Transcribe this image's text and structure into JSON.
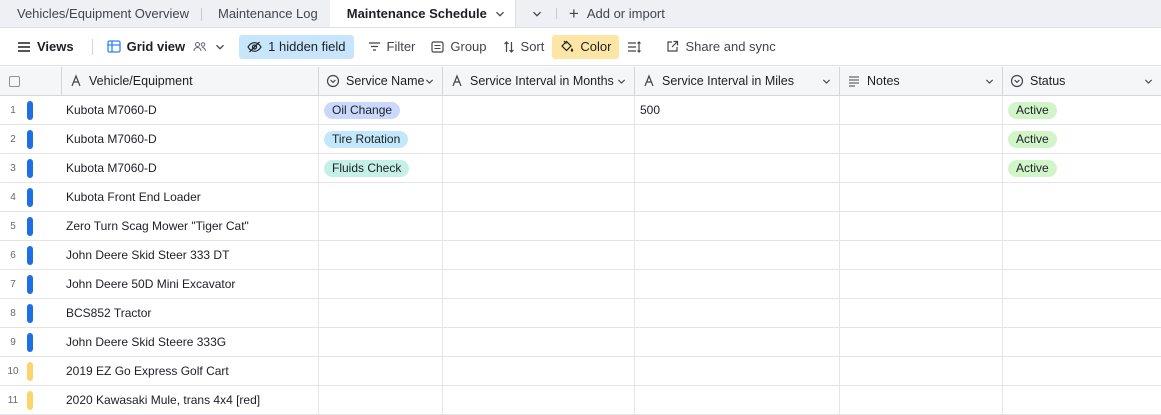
{
  "tabs": [
    {
      "label": "Vehicles/Equipment Overview",
      "active": false
    },
    {
      "label": "Maintenance Log",
      "active": false
    },
    {
      "label": "Maintenance Schedule",
      "active": true
    }
  ],
  "add_import_label": "Add or import",
  "toolbar": {
    "views": "Views",
    "grid_view": "Grid view",
    "hidden_field": "1 hidden field",
    "filter": "Filter",
    "group": "Group",
    "sort": "Sort",
    "color": "Color",
    "share": "Share and sync"
  },
  "columns": {
    "vehicle": "Vehicle/Equipment",
    "service_name": "Service Name",
    "interval_months": "Service Interval in Months",
    "interval_miles": "Service Interval in Miles",
    "notes": "Notes",
    "status": "Status"
  },
  "colors": {
    "blue_stripe": "#1e6fe6",
    "yellow_stripe": "#fcd56a",
    "oil_change": "#c9d8fb",
    "tire_rotation": "#c3e8fb",
    "fluids_check": "#c5f0e7",
    "active": "#d1f5c9"
  },
  "rows": [
    {
      "num": "1",
      "vehicle": "Kubota M7060-D",
      "service": "Oil Change",
      "service_color": "#c9d8fb",
      "months": "",
      "miles": "500",
      "notes": "",
      "status": "Active",
      "stripe": "#1e6fe6"
    },
    {
      "num": "2",
      "vehicle": "Kubota M7060-D",
      "service": "Tire Rotation",
      "service_color": "#c3e8fb",
      "months": "",
      "miles": "",
      "notes": "",
      "status": "Active",
      "stripe": "#1e6fe6"
    },
    {
      "num": "3",
      "vehicle": "Kubota M7060-D",
      "service": "Fluids Check",
      "service_color": "#c5f0e7",
      "months": "",
      "miles": "",
      "notes": "",
      "status": "Active",
      "stripe": "#1e6fe6"
    },
    {
      "num": "4",
      "vehicle": "Kubota Front End Loader",
      "service": "",
      "service_color": "",
      "months": "",
      "miles": "",
      "notes": "",
      "status": "",
      "stripe": "#1e6fe6"
    },
    {
      "num": "5",
      "vehicle": "Zero Turn Scag Mower \"Tiger Cat\"",
      "service": "",
      "service_color": "",
      "months": "",
      "miles": "",
      "notes": "",
      "status": "",
      "stripe": "#1e6fe6"
    },
    {
      "num": "6",
      "vehicle": "John Deere Skid Steer 333 DT",
      "service": "",
      "service_color": "",
      "months": "",
      "miles": "",
      "notes": "",
      "status": "",
      "stripe": "#1e6fe6"
    },
    {
      "num": "7",
      "vehicle": "John Deere 50D Mini Excavator",
      "service": "",
      "service_color": "",
      "months": "",
      "miles": "",
      "notes": "",
      "status": "",
      "stripe": "#1e6fe6"
    },
    {
      "num": "8",
      "vehicle": "BCS852 Tractor",
      "service": "",
      "service_color": "",
      "months": "",
      "miles": "",
      "notes": "",
      "status": "",
      "stripe": "#1e6fe6"
    },
    {
      "num": "9",
      "vehicle": "John Deere Skid Steere 333G",
      "service": "",
      "service_color": "",
      "months": "",
      "miles": "",
      "notes": "",
      "status": "",
      "stripe": "#1e6fe6"
    },
    {
      "num": "10",
      "vehicle": "2019 EZ Go Express Golf Cart",
      "service": "",
      "service_color": "",
      "months": "",
      "miles": "",
      "notes": "",
      "status": "",
      "stripe": "#fcd56a"
    },
    {
      "num": "11",
      "vehicle": "2020 Kawasaki Mule, trans 4x4 [red]",
      "service": "",
      "service_color": "",
      "months": "",
      "miles": "",
      "notes": "",
      "status": "",
      "stripe": "#fcd56a"
    }
  ]
}
